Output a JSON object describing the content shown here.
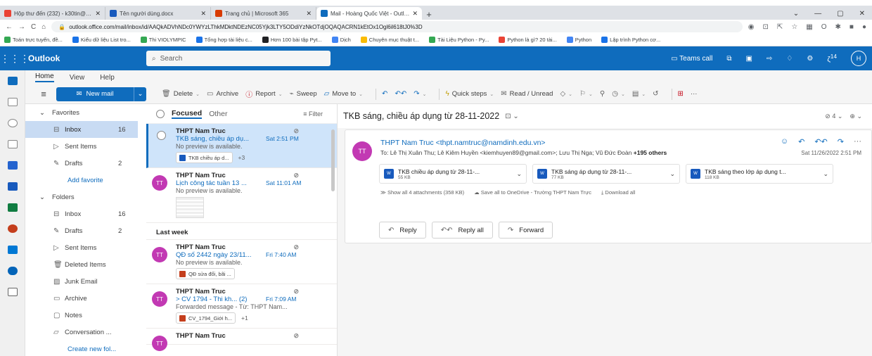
{
  "browser": {
    "tabs": [
      {
        "title": "Hộp thư đến (232) - k30tin@gm...",
        "color": "#ea4335",
        "active": false
      },
      {
        "title": "Tên người dùng.docx",
        "color": "#185abd",
        "active": false
      },
      {
        "title": "Trang chủ | Microsoft 365",
        "color": "#d83b01",
        "active": false
      },
      {
        "title": "Mail - Hoàng Quốc Việt - Outloo",
        "color": "#0f6cbd",
        "active": true
      }
    ],
    "new_tab": "+",
    "window_controls": [
      "⌄",
      "—",
      "▢",
      "✕"
    ],
    "url": "outlook.office.com/mail/inbox/id/AAQkADVhNDc0YWYzLThkMDktNDEzNC05Yjk3LTY5ODdiYzNkOTdjOQAQACRN1kEtOx1Ogl6il618tJ0%3D",
    "bookmarks": [
      {
        "label": "Toán trực tuyến, đề...",
        "color": "#34a853"
      },
      {
        "label": "Kiểu dữ liệu List tro...",
        "color": "#1a73e8"
      },
      {
        "label": "Thi VIOLYMPIC",
        "color": "#34a853"
      },
      {
        "label": "Tổng hợp tài liệu c...",
        "color": "#1a73e8"
      },
      {
        "label": "Hơn 100 bài tập Pyt...",
        "color": "#202124"
      },
      {
        "label": "Dịch",
        "color": "#4285f4"
      },
      {
        "label": "Chuyên mục thuật t...",
        "color": "#fbbc04"
      },
      {
        "label": "Tài Liệu Python - Py...",
        "color": "#34a853"
      },
      {
        "label": "Python là gì? 20 tài...",
        "color": "#ea4335"
      },
      {
        "label": "Python",
        "color": "#4285f4"
      },
      {
        "label": "Lập trình Python cơ...",
        "color": "#1a73e8"
      }
    ]
  },
  "suite": {
    "brand": "Outlook",
    "search_placeholder": "Search",
    "teams_call": "Teams call",
    "avatar": "H",
    "badge": "14"
  },
  "ribbon": {
    "tabs": [
      "Home",
      "View",
      "Help"
    ],
    "new_mail": "New mail",
    "delete": "Delete",
    "archive": "Archive",
    "report": "Report",
    "sweep": "Sweep",
    "move_to": "Move to",
    "quick_steps": "Quick steps",
    "read_unread": "Read / Unread",
    "more": "···"
  },
  "folders": {
    "favorites": "Favorites",
    "fav_items": [
      {
        "name": "Inbox",
        "count": "16",
        "icon": "inbox-icon"
      },
      {
        "name": "Sent Items",
        "count": "",
        "icon": "send-icon"
      },
      {
        "name": "Drafts",
        "count": "2",
        "icon": "pencil-icon"
      }
    ],
    "add_favorite": "Add favorite",
    "folders_label": "Folders",
    "folder_items": [
      {
        "name": "Inbox",
        "count": "16"
      },
      {
        "name": "Drafts",
        "count": "2"
      },
      {
        "name": "Sent Items",
        "count": ""
      },
      {
        "name": "Deleted Items",
        "count": ""
      },
      {
        "name": "Junk Email",
        "count": ""
      },
      {
        "name": "Archive",
        "count": ""
      },
      {
        "name": "Notes",
        "count": ""
      },
      {
        "name": "Conversation ...",
        "count": ""
      }
    ],
    "create_new": "Create new fol..."
  },
  "list": {
    "focused": "Focused",
    "other": "Other",
    "filter": "Filter",
    "last_week": "Last week",
    "messages": [
      {
        "from": "THPT Nam Truc",
        "subject": "TKB sáng, chiều áp dụ...",
        "date": "Sat 2:51 PM",
        "preview": "No preview is available.",
        "chip": "TKB chiều áp d...",
        "extra": "+3"
      },
      {
        "from": "THPT Nam Truc",
        "subject": "Lịch công tác tuần 13 ...",
        "date": "Sat 11:01 AM",
        "preview": "No preview is available."
      },
      {
        "from": "THPT Nam Truc",
        "subject": "QĐ số 2442 ngày 23/11...",
        "date": "Fri 7:40 AM",
        "preview": "No preview is available.",
        "chip": "QĐ sửa đổi, bãi ..."
      },
      {
        "from": "THPT Nam Truc",
        "subject": "> CV 1794 - Thi kh...  (2)",
        "date": "Fri 7:09 AM",
        "preview": "Forwarded message - Từ: THPT Nam...",
        "chip": "CV_1794_Giới h...",
        "extra": "+1"
      },
      {
        "from": "THPT Nam Truc"
      }
    ]
  },
  "reading": {
    "subject": "TKB sáng, chiều áp dụng từ 28-11-2022",
    "zoom": "4",
    "sender": "THPT Nam Truc <thpt.namtruc@namdinh.edu.vn>",
    "to_prefix": "To:  Lê Thị Xuân Thu;  Lê Kiêm Huyền <kiemhuyen89@gmail.com>;  Lưu Thị Nga;  Vũ Đức Đoàn",
    "to_others": "+195 others",
    "date": "Sat 11/26/2022 2:51 PM",
    "attachments": [
      {
        "name": "TKB chiều áp dụng từ 28-11-...",
        "size": "55 KB"
      },
      {
        "name": "TKB sáng áp dụng từ 28-11-...",
        "size": "77 KB"
      },
      {
        "name": "TKB sáng theo lớp áp dụng t...",
        "size": "118 KB"
      }
    ],
    "show_all": "Show all 4 attachments (358 KB)",
    "save_all": "Save all to OneDrive - Trường THPT Nam Trực",
    "download_all": "Download all",
    "reply": "Reply",
    "reply_all": "Reply all",
    "forward": "Forward"
  }
}
